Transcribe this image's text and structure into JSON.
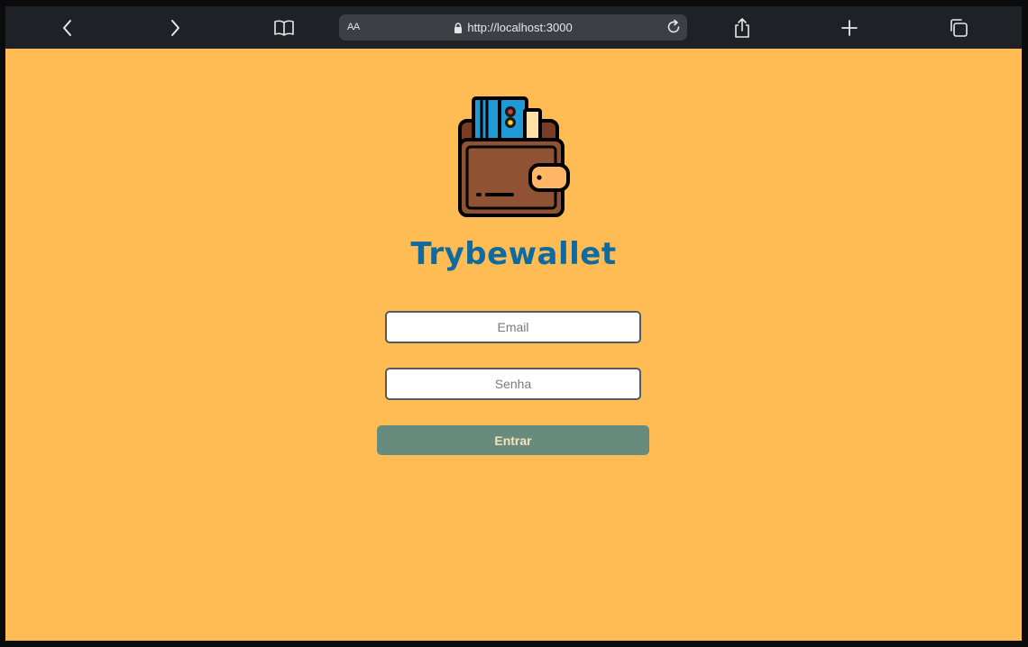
{
  "browser": {
    "reader_label": "AA",
    "url": "http://localhost:3000"
  },
  "page": {
    "title": "Trybewallet",
    "email_placeholder": "Email",
    "password_placeholder": "Senha",
    "submit_label": "Entrar"
  },
  "colors": {
    "background": "#ffbc54",
    "title": "#0e6aa0",
    "button": "#678c7e"
  }
}
